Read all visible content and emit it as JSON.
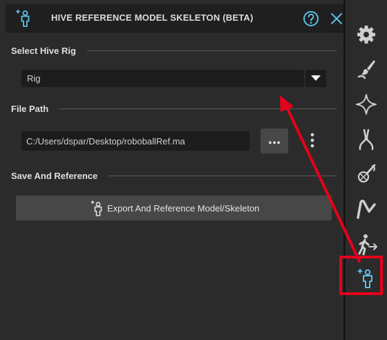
{
  "header": {
    "title": "HIVE REFERENCE MODEL SKELETON (BETA)",
    "logo_icon": "hive-person-icon",
    "help_icon": "question-circle-icon",
    "close_icon": "close-x-icon"
  },
  "sections": {
    "select_rig": "Select Hive Rig",
    "file_path": "File Path",
    "save_reference": "Save And Reference"
  },
  "rig_select": {
    "selected": "Rig"
  },
  "file_path": {
    "value": "C:/Users/dspar/Desktop/roboballRef.ma"
  },
  "browse_button": {
    "label": "..."
  },
  "export_button": {
    "label": "Export And Reference Model/Skeleton"
  },
  "toolbar": {
    "items": [
      "gear-icon",
      "paint-brush-icon",
      "sparkle-star-icon",
      "pliers-icon",
      "fishing-net-icon",
      "leg-bend-icon",
      "walk-exit-icon",
      "hive-person-icon"
    ],
    "active": "hive-person-icon"
  },
  "colors": {
    "accent": "#5bc0e8",
    "highlight": "#e8001a",
    "panel_bg": "#2b2b2b",
    "field_bg": "#1c1c1c",
    "button_bg": "#474747"
  }
}
